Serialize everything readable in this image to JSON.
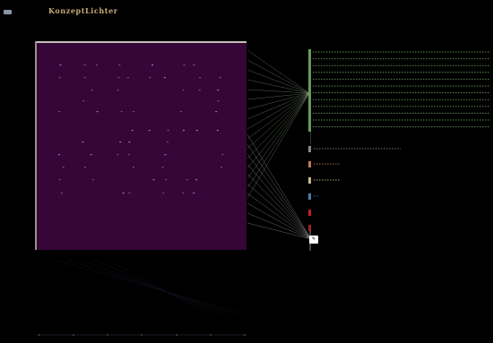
{
  "app": {
    "title": "KonzeptLichter"
  },
  "colors": {
    "background": "#000000",
    "panel": "#360638",
    "accent_green": "#6a9a5a",
    "link_color": "#b8d8b0",
    "title_color": "#c9a978"
  },
  "icons": {
    "corner": "menu-icon"
  },
  "selection_badge": {
    "icon": "pencil-icon"
  },
  "categories": [
    {
      "color": "#8a8a8a",
      "fill": 0.44
    },
    {
      "color": "#c07a5a",
      "fill": 0.13
    },
    {
      "color": "#c8b890",
      "fill": 0.13
    },
    {
      "color": "#4a7aa8",
      "fill": 0.02
    },
    {
      "color": "#c02020",
      "fill": 0.0
    },
    {
      "color": "#a02020",
      "fill": 0.0
    }
  ],
  "green_rows": 12
}
